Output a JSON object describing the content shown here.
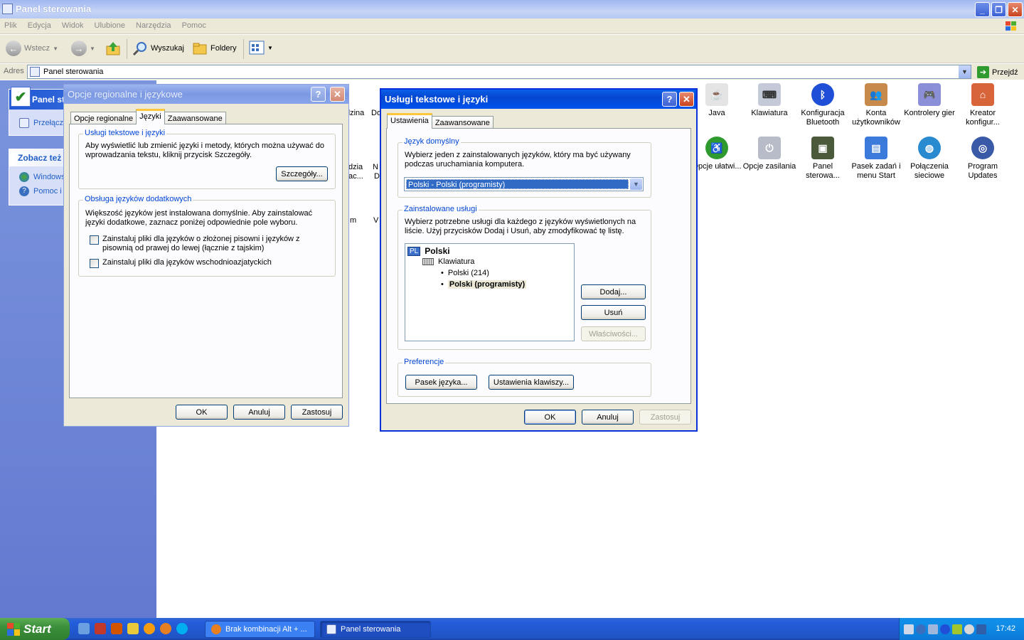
{
  "window": {
    "title": "Panel sterowania",
    "menu": [
      "Plik",
      "Edycja",
      "Widok",
      "Ulubione",
      "Narzędzia",
      "Pomoc"
    ],
    "toolbar": {
      "back": "Wstecz",
      "search": "Wyszukaj",
      "folders": "Foldery"
    },
    "address": {
      "label": "Adres",
      "value": "Panel sterowania",
      "go": "Przejdź"
    }
  },
  "taskpane": {
    "panel_title": "Panel st",
    "switch_link": "Przełącz",
    "see_also_title": "Zobacz też",
    "links": [
      "Windows",
      "Pomoc i"
    ]
  },
  "icons": [
    {
      "label": "Java",
      "icon": "java-icon",
      "color": "#d9d9d9"
    },
    {
      "label": "Klawiatura",
      "icon": "keyboard-icon",
      "color": "#9aa4bb"
    },
    {
      "label": "Konfiguracja Bluetooth",
      "icon": "bluetooth-icon",
      "color": "#1f4fd6"
    },
    {
      "label": "Konta użytkowników",
      "icon": "users-icon",
      "color": "#c88a4a"
    },
    {
      "label": "Kontrolery gier",
      "icon": "gamepad-icon",
      "color": "#8b8fd8"
    },
    {
      "label": "Kreator konfigur...",
      "icon": "network-wizard-icon",
      "color": "#d8643a"
    },
    {
      "label": "Opcje ułatwi...",
      "icon": "accessibility-icon",
      "color": "#2f9b2f"
    },
    {
      "label": "Opcje zasilania",
      "icon": "power-icon",
      "color": "#b8bcc8"
    },
    {
      "label": "Panel sterowa...",
      "icon": "nvidia-panel-icon",
      "color": "#4a5a3a"
    },
    {
      "label": "Pasek zadań i menu Start",
      "icon": "taskbar-icon",
      "color": "#3b7ad8"
    },
    {
      "label": "Połączenia sieciowe",
      "icon": "network-icon",
      "color": "#2a8ad0"
    },
    {
      "label": "Program Updates",
      "icon": "program-updates-icon",
      "color": "#3a5aa8"
    }
  ],
  "hidden_icon_fragments": [
    "dzina",
    "Do",
    "dzia",
    "N",
    "ac...",
    "D",
    "m",
    "V"
  ],
  "dialog_regional": {
    "title": "Opcje regionalne i językowe",
    "tabs": [
      "Opcje regionalne",
      "Języki",
      "Zaawansowane"
    ],
    "active_tab": 1,
    "group1": {
      "legend": "Usługi tekstowe i języki",
      "text": "Aby wyświetlić lub zmienić języki i metody, których można używać do wprowadzania tekstu, kliknij przycisk Szczegóły.",
      "button": "Szczegóły..."
    },
    "group2": {
      "legend": "Obsługa języków dodatkowych",
      "text": "Większość języków jest instalowana domyślnie. Aby zainstalować języki dodatkowe, zaznacz poniżej odpowiednie pole wyboru.",
      "checkbox1": "Zainstaluj pliki dla języków o złożonej pisowni i języków z pisownią od prawej do lewej (łącznie z tajskim)",
      "checkbox2": "Zainstaluj pliki dla języków wschodnioazjatyckich"
    },
    "buttons": {
      "ok": "OK",
      "cancel": "Anuluj",
      "apply": "Zastosuj"
    }
  },
  "dialog_text": {
    "title": "Usługi tekstowe i języki",
    "tabs": [
      "Ustawienia",
      "Zaawansowane"
    ],
    "active_tab": 0,
    "default_lang": {
      "legend": "Język domyślny",
      "text": "Wybierz jeden z zainstalowanych języków, który ma być używany podczas uruchamiania komputera.",
      "selected": "Polski - Polski (programisty)"
    },
    "installed": {
      "legend": "Zainstalowane usługi",
      "text": "Wybierz potrzebne usługi dla każdego z języków wyświetlonych na liście. Użyj przycisków Dodaj i Usuń, aby zmodyfikować tę listę.",
      "tree": {
        "badge": "PL",
        "language": "Polski",
        "category": "Klawiatura",
        "items": [
          "Polski (214)",
          "Polski (programisty)"
        ]
      },
      "add": "Dodaj...",
      "remove": "Usuń",
      "properties": "Właściwości..."
    },
    "prefs": {
      "legend": "Preferencje",
      "langbar": "Pasek języka...",
      "keys": "Ustawienia klawiszy..."
    },
    "buttons": {
      "ok": "OK",
      "cancel": "Anuluj",
      "apply": "Zastosuj"
    }
  },
  "taskbar": {
    "start": "Start",
    "tasks": [
      "Brak kombinacji Alt + ...",
      "Panel sterowania"
    ],
    "clock": "17:42"
  }
}
